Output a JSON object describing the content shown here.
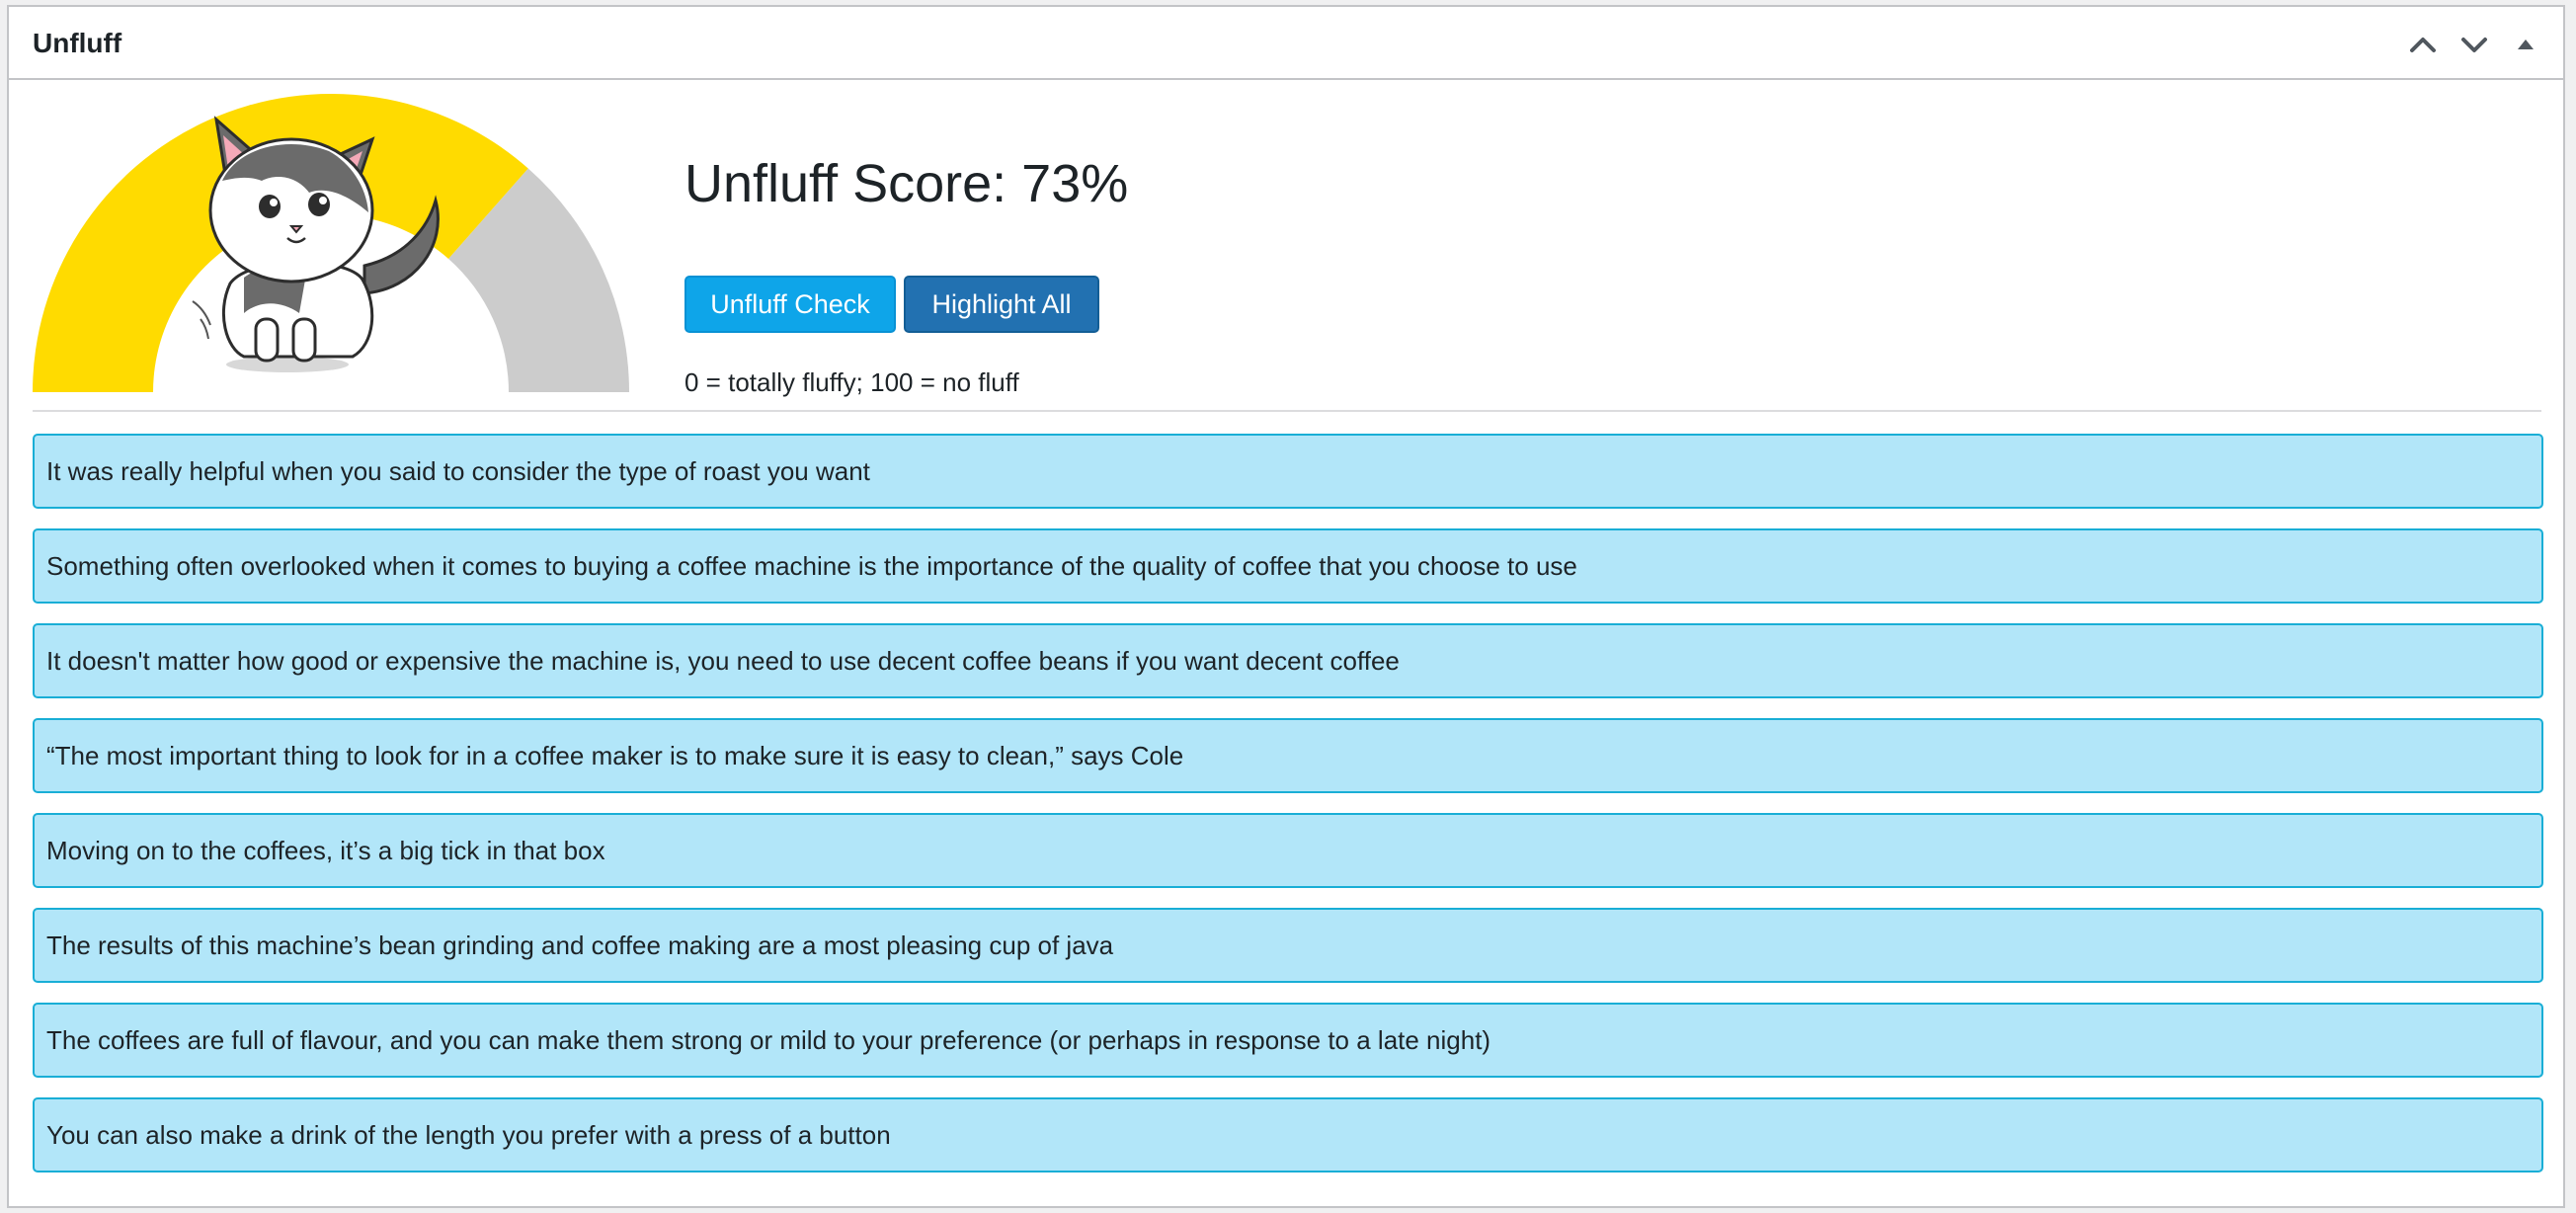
{
  "panel": {
    "title": "Unfluff",
    "controls": {
      "move_up": "chevron-up-icon",
      "move_down": "chevron-down-icon",
      "toggle": "triangle-up-icon"
    }
  },
  "score": {
    "title": "Unfluff Score: 73%",
    "value_percent": 73,
    "legend": "0 = totally fluffy; 100 = no fluff"
  },
  "gauge": {
    "fill_color": "#ffdb00",
    "track_color": "#cccccc",
    "value_fraction": 0.73,
    "mascot": "cat-illustration"
  },
  "buttons": {
    "check_label": "Unfluff Check",
    "highlight_label": "Highlight All"
  },
  "colors": {
    "sentence_bg": "#b2e6f9",
    "sentence_border": "#19aed6",
    "check_button": "#0ea5e9",
    "highlight_button": "#2271b1"
  },
  "sentences": [
    "It was really helpful when you said to consider the type of roast you want",
    "Something often overlooked when it comes to buying a coffee machine is the importance of the quality of coffee that you choose to use",
    "It doesn't matter how good or expensive the machine is, you need to use decent coffee beans if you want decent coffee",
    "“The most important thing to look for in a coffee maker is to make sure it is easy to clean,” says Cole",
    "Moving on to the coffees, it’s a big tick in that box",
    "The results of this machine’s bean grinding and coffee making are a most pleasing cup of java",
    "The coffees are full of flavour, and you can make them strong or mild to your preference (or perhaps in response to a late night)",
    "You can also make a drink of the length you prefer with a press of a button"
  ]
}
